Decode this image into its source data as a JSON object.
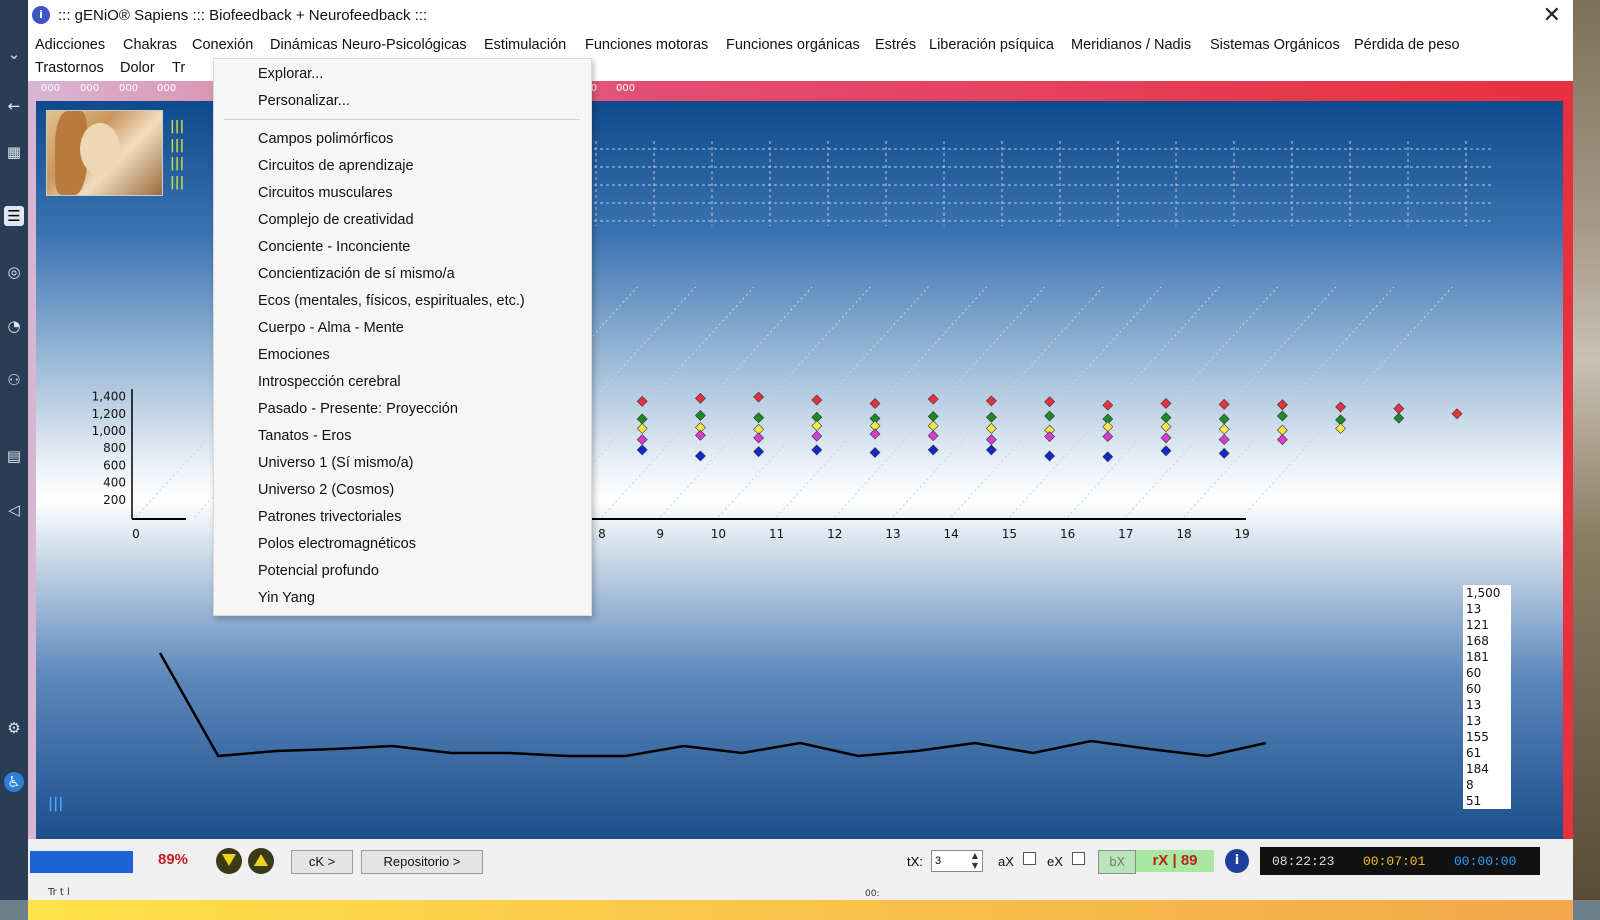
{
  "window": {
    "title": "::: gENiO® Sapiens ::: Biofeedback + Neurofeedback :::",
    "close_glyph": "✕"
  },
  "menu": {
    "row1": [
      "Adicciones",
      "Chakras",
      "Conexión",
      "Dinámicas Neuro-Psicológicas",
      "Estimulación",
      "Funciones motoras",
      "Funciones orgánicas",
      "Estrés",
      "Liberación psíquica",
      "Meridianos / Nadis",
      "Sistemas Orgánicos",
      "Pérdida de peso"
    ],
    "row2": [
      "Trastornos",
      "Dolor",
      "Tr"
    ]
  },
  "dropdown": {
    "items_top": [
      "Explorar...",
      "Personalizar..."
    ],
    "items": [
      "Campos polimórficos",
      "Circuitos de aprendizaje",
      "Circuitos musculares",
      "Complejo de creatividad",
      "Conciente - Inconciente",
      "Concientización de sí mismo/a",
      "Ecos (mentales, físicos, espirituales, etc.)",
      "Cuerpo - Alma - Mente",
      "Emociones",
      "Introspección cerebral",
      "Pasado - Presente: Proyección",
      "Tanatos - Eros",
      "Universo 1 (Sí mismo/a)",
      "Universo 2 (Cosmos)",
      "Patrones trivectoriales",
      "Polos electromagnéticos",
      "Potencial profundo",
      "Yin Yang"
    ]
  },
  "top_strip": {
    "left_codes": [
      "000",
      "000",
      "000",
      "000"
    ],
    "right_codes": [
      "000",
      "000"
    ]
  },
  "value_list": [
    "1,500",
    "13",
    "121",
    "168",
    "181",
    "60",
    "60",
    "13",
    "13",
    "155",
    "61",
    "184",
    "8",
    "51"
  ],
  "bars_glyph": "|||",
  "colors": {
    "red": "#e8303e",
    "green": "#1a8a2a",
    "yellow": "#f2e84a",
    "magenta": "#d43ed0",
    "blue": "#1228c8"
  },
  "chart_data": {
    "type": "scatter",
    "y_ticks": [
      "1,400",
      "1,200",
      "1,000",
      "800",
      "600",
      "400",
      "200"
    ],
    "x_ticks": [
      "0",
      "8",
      "9",
      "10",
      "11",
      "12",
      "13",
      "14",
      "15",
      "16",
      "17",
      "18",
      "19"
    ],
    "x_tick_values": [
      0,
      8,
      9,
      10,
      11,
      12,
      13,
      14,
      15,
      16,
      17,
      18,
      19
    ],
    "series": [
      {
        "color": "red",
        "x": [
          8,
          9,
          10,
          11,
          12,
          13,
          14,
          15,
          16,
          17,
          18,
          19,
          20,
          21,
          22,
          23
        ],
        "y": [
          1290,
          1345,
          1380,
          1395,
          1360,
          1320,
          1370,
          1350,
          1340,
          1300,
          1320,
          1310,
          1305,
          1280,
          1260,
          1200
        ]
      },
      {
        "color": "green",
        "x": [
          8,
          9,
          10,
          11,
          12,
          13,
          14,
          15,
          16,
          17,
          18,
          19,
          20,
          21,
          22
        ],
        "y": [
          1165,
          1140,
          1180,
          1155,
          1160,
          1145,
          1170,
          1160,
          1175,
          1140,
          1155,
          1140,
          1175,
          1130,
          1150
        ]
      },
      {
        "color": "yellow",
        "x": [
          8,
          9,
          10,
          11,
          12,
          13,
          14,
          15,
          16,
          17,
          18,
          19,
          20,
          21
        ],
        "y": [
          1020,
          1030,
          1040,
          1020,
          1060,
          1060,
          1060,
          1030,
          1010,
          1050,
          1050,
          1020,
          1010,
          1030
        ]
      },
      {
        "color": "magenta",
        "x": [
          8,
          9,
          10,
          11,
          12,
          13,
          14,
          15,
          16,
          17,
          18,
          19,
          20
        ],
        "y": [
          870,
          900,
          950,
          920,
          940,
          965,
          945,
          900,
          935,
          935,
          920,
          900,
          900
        ]
      },
      {
        "color": "blue",
        "x": [
          8,
          9,
          10,
          11,
          12,
          13,
          14,
          15,
          16,
          17,
          18,
          19
        ],
        "y": [
          760,
          780,
          710,
          760,
          780,
          750,
          780,
          780,
          710,
          700,
          770,
          740
        ]
      }
    ],
    "line_y": [
      1500,
      13,
      121,
      168,
      181,
      60,
      60,
      13,
      13,
      155,
      61,
      184,
      8,
      51,
      100,
      140,
      90,
      170,
      110,
      80,
      60,
      130
    ],
    "line_ylim": [
      0,
      1500
    ]
  },
  "status": {
    "percent": "89%",
    "ck_button": "cK >",
    "repo_button": "Repositorio >",
    "tx_label": "tX:",
    "tx_value": "3",
    "ax_label": "aX",
    "ex_label": "eX",
    "bx_label": "bX",
    "rx_text": "rX | 89",
    "clock": "08:22:23",
    "elapsed": "00:07:01",
    "timer": "00:00:00",
    "bottom_text_fragment": "Tr          t   l",
    "bottom_pct_fragment": "00:"
  }
}
